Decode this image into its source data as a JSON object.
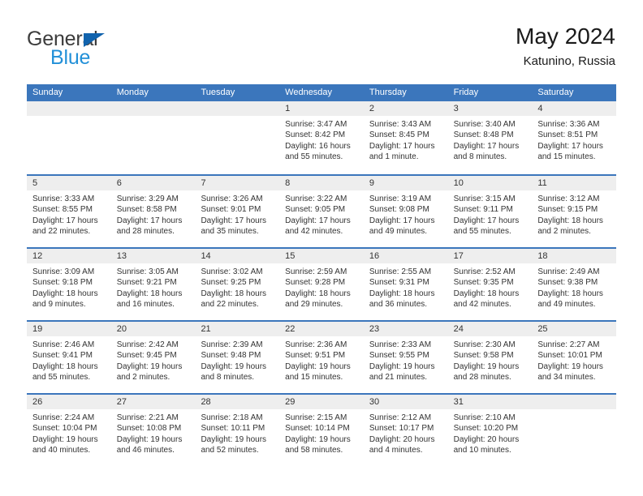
{
  "brand": {
    "name_part1": "General",
    "name_part2": "Blue",
    "colors": {
      "dark": "#3c3c3c",
      "blue": "#2290d8",
      "triangle": "#1163ad"
    }
  },
  "header": {
    "title": "May 2024",
    "subtitle": "Katunino, Russia"
  },
  "theme": {
    "header_blue": "#3b76bc",
    "daynum_band": "#eeeeee",
    "text": "#333333"
  },
  "weekdays": [
    "Sunday",
    "Monday",
    "Tuesday",
    "Wednesday",
    "Thursday",
    "Friday",
    "Saturday"
  ],
  "weeks": [
    {
      "days": [
        {
          "num": "",
          "sunrise": "",
          "sunset": "",
          "daylight_line1": "",
          "daylight_line2": "",
          "empty": true
        },
        {
          "num": "",
          "sunrise": "",
          "sunset": "",
          "daylight_line1": "",
          "daylight_line2": "",
          "empty": true
        },
        {
          "num": "",
          "sunrise": "",
          "sunset": "",
          "daylight_line1": "",
          "daylight_line2": "",
          "empty": true
        },
        {
          "num": "1",
          "sunrise": "Sunrise: 3:47 AM",
          "sunset": "Sunset: 8:42 PM",
          "daylight_line1": "Daylight: 16 hours",
          "daylight_line2": "and 55 minutes.",
          "empty": false
        },
        {
          "num": "2",
          "sunrise": "Sunrise: 3:43 AM",
          "sunset": "Sunset: 8:45 PM",
          "daylight_line1": "Daylight: 17 hours",
          "daylight_line2": "and 1 minute.",
          "empty": false
        },
        {
          "num": "3",
          "sunrise": "Sunrise: 3:40 AM",
          "sunset": "Sunset: 8:48 PM",
          "daylight_line1": "Daylight: 17 hours",
          "daylight_line2": "and 8 minutes.",
          "empty": false
        },
        {
          "num": "4",
          "sunrise": "Sunrise: 3:36 AM",
          "sunset": "Sunset: 8:51 PM",
          "daylight_line1": "Daylight: 17 hours",
          "daylight_line2": "and 15 minutes.",
          "empty": false
        }
      ]
    },
    {
      "days": [
        {
          "num": "5",
          "sunrise": "Sunrise: 3:33 AM",
          "sunset": "Sunset: 8:55 PM",
          "daylight_line1": "Daylight: 17 hours",
          "daylight_line2": "and 22 minutes.",
          "empty": false
        },
        {
          "num": "6",
          "sunrise": "Sunrise: 3:29 AM",
          "sunset": "Sunset: 8:58 PM",
          "daylight_line1": "Daylight: 17 hours",
          "daylight_line2": "and 28 minutes.",
          "empty": false
        },
        {
          "num": "7",
          "sunrise": "Sunrise: 3:26 AM",
          "sunset": "Sunset: 9:01 PM",
          "daylight_line1": "Daylight: 17 hours",
          "daylight_line2": "and 35 minutes.",
          "empty": false
        },
        {
          "num": "8",
          "sunrise": "Sunrise: 3:22 AM",
          "sunset": "Sunset: 9:05 PM",
          "daylight_line1": "Daylight: 17 hours",
          "daylight_line2": "and 42 minutes.",
          "empty": false
        },
        {
          "num": "9",
          "sunrise": "Sunrise: 3:19 AM",
          "sunset": "Sunset: 9:08 PM",
          "daylight_line1": "Daylight: 17 hours",
          "daylight_line2": "and 49 minutes.",
          "empty": false
        },
        {
          "num": "10",
          "sunrise": "Sunrise: 3:15 AM",
          "sunset": "Sunset: 9:11 PM",
          "daylight_line1": "Daylight: 17 hours",
          "daylight_line2": "and 55 minutes.",
          "empty": false
        },
        {
          "num": "11",
          "sunrise": "Sunrise: 3:12 AM",
          "sunset": "Sunset: 9:15 PM",
          "daylight_line1": "Daylight: 18 hours",
          "daylight_line2": "and 2 minutes.",
          "empty": false
        }
      ]
    },
    {
      "days": [
        {
          "num": "12",
          "sunrise": "Sunrise: 3:09 AM",
          "sunset": "Sunset: 9:18 PM",
          "daylight_line1": "Daylight: 18 hours",
          "daylight_line2": "and 9 minutes.",
          "empty": false
        },
        {
          "num": "13",
          "sunrise": "Sunrise: 3:05 AM",
          "sunset": "Sunset: 9:21 PM",
          "daylight_line1": "Daylight: 18 hours",
          "daylight_line2": "and 16 minutes.",
          "empty": false
        },
        {
          "num": "14",
          "sunrise": "Sunrise: 3:02 AM",
          "sunset": "Sunset: 9:25 PM",
          "daylight_line1": "Daylight: 18 hours",
          "daylight_line2": "and 22 minutes.",
          "empty": false
        },
        {
          "num": "15",
          "sunrise": "Sunrise: 2:59 AM",
          "sunset": "Sunset: 9:28 PM",
          "daylight_line1": "Daylight: 18 hours",
          "daylight_line2": "and 29 minutes.",
          "empty": false
        },
        {
          "num": "16",
          "sunrise": "Sunrise: 2:55 AM",
          "sunset": "Sunset: 9:31 PM",
          "daylight_line1": "Daylight: 18 hours",
          "daylight_line2": "and 36 minutes.",
          "empty": false
        },
        {
          "num": "17",
          "sunrise": "Sunrise: 2:52 AM",
          "sunset": "Sunset: 9:35 PM",
          "daylight_line1": "Daylight: 18 hours",
          "daylight_line2": "and 42 minutes.",
          "empty": false
        },
        {
          "num": "18",
          "sunrise": "Sunrise: 2:49 AM",
          "sunset": "Sunset: 9:38 PM",
          "daylight_line1": "Daylight: 18 hours",
          "daylight_line2": "and 49 minutes.",
          "empty": false
        }
      ]
    },
    {
      "days": [
        {
          "num": "19",
          "sunrise": "Sunrise: 2:46 AM",
          "sunset": "Sunset: 9:41 PM",
          "daylight_line1": "Daylight: 18 hours",
          "daylight_line2": "and 55 minutes.",
          "empty": false
        },
        {
          "num": "20",
          "sunrise": "Sunrise: 2:42 AM",
          "sunset": "Sunset: 9:45 PM",
          "daylight_line1": "Daylight: 19 hours",
          "daylight_line2": "and 2 minutes.",
          "empty": false
        },
        {
          "num": "21",
          "sunrise": "Sunrise: 2:39 AM",
          "sunset": "Sunset: 9:48 PM",
          "daylight_line1": "Daylight: 19 hours",
          "daylight_line2": "and 8 minutes.",
          "empty": false
        },
        {
          "num": "22",
          "sunrise": "Sunrise: 2:36 AM",
          "sunset": "Sunset: 9:51 PM",
          "daylight_line1": "Daylight: 19 hours",
          "daylight_line2": "and 15 minutes.",
          "empty": false
        },
        {
          "num": "23",
          "sunrise": "Sunrise: 2:33 AM",
          "sunset": "Sunset: 9:55 PM",
          "daylight_line1": "Daylight: 19 hours",
          "daylight_line2": "and 21 minutes.",
          "empty": false
        },
        {
          "num": "24",
          "sunrise": "Sunrise: 2:30 AM",
          "sunset": "Sunset: 9:58 PM",
          "daylight_line1": "Daylight: 19 hours",
          "daylight_line2": "and 28 minutes.",
          "empty": false
        },
        {
          "num": "25",
          "sunrise": "Sunrise: 2:27 AM",
          "sunset": "Sunset: 10:01 PM",
          "daylight_line1": "Daylight: 19 hours",
          "daylight_line2": "and 34 minutes.",
          "empty": false
        }
      ]
    },
    {
      "days": [
        {
          "num": "26",
          "sunrise": "Sunrise: 2:24 AM",
          "sunset": "Sunset: 10:04 PM",
          "daylight_line1": "Daylight: 19 hours",
          "daylight_line2": "and 40 minutes.",
          "empty": false
        },
        {
          "num": "27",
          "sunrise": "Sunrise: 2:21 AM",
          "sunset": "Sunset: 10:08 PM",
          "daylight_line1": "Daylight: 19 hours",
          "daylight_line2": "and 46 minutes.",
          "empty": false
        },
        {
          "num": "28",
          "sunrise": "Sunrise: 2:18 AM",
          "sunset": "Sunset: 10:11 PM",
          "daylight_line1": "Daylight: 19 hours",
          "daylight_line2": "and 52 minutes.",
          "empty": false
        },
        {
          "num": "29",
          "sunrise": "Sunrise: 2:15 AM",
          "sunset": "Sunset: 10:14 PM",
          "daylight_line1": "Daylight: 19 hours",
          "daylight_line2": "and 58 minutes.",
          "empty": false
        },
        {
          "num": "30",
          "sunrise": "Sunrise: 2:12 AM",
          "sunset": "Sunset: 10:17 PM",
          "daylight_line1": "Daylight: 20 hours",
          "daylight_line2": "and 4 minutes.",
          "empty": false
        },
        {
          "num": "31",
          "sunrise": "Sunrise: 2:10 AM",
          "sunset": "Sunset: 10:20 PM",
          "daylight_line1": "Daylight: 20 hours",
          "daylight_line2": "and 10 minutes.",
          "empty": false
        },
        {
          "num": "",
          "sunrise": "",
          "sunset": "",
          "daylight_line1": "",
          "daylight_line2": "",
          "empty": true
        }
      ]
    }
  ]
}
